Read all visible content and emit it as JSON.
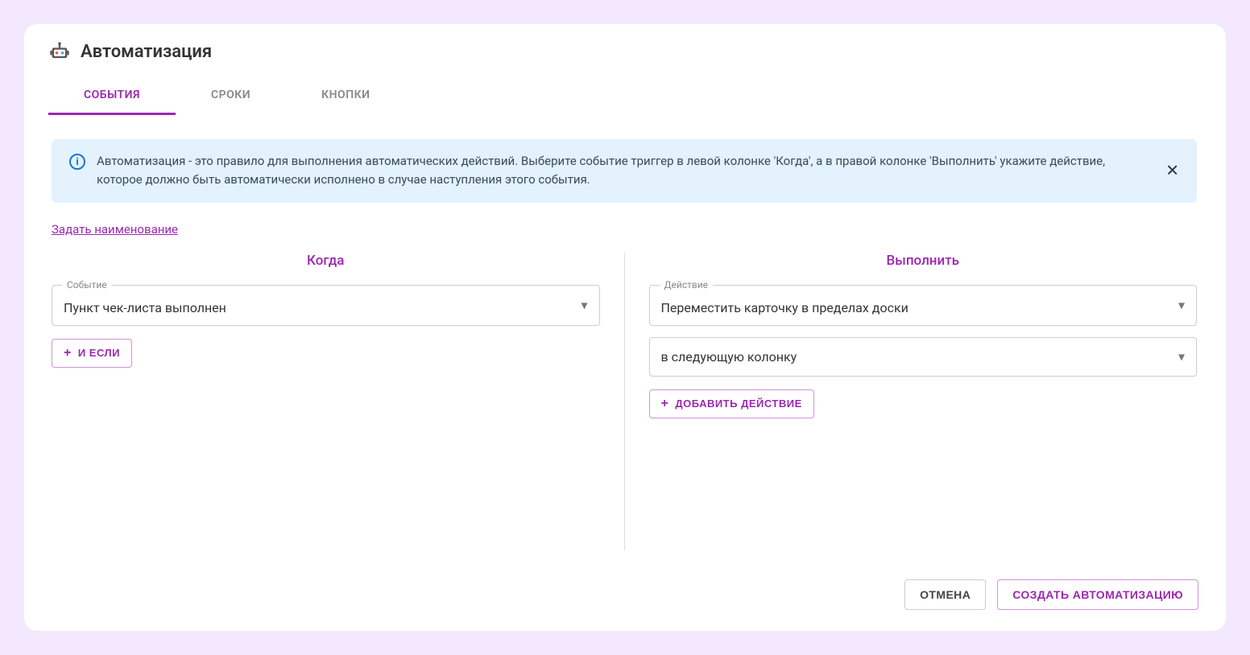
{
  "header": {
    "title": "Автоматизация"
  },
  "tabs": {
    "items": [
      {
        "label": "СОБЫТИЯ",
        "active": true
      },
      {
        "label": "СРОКИ",
        "active": false
      },
      {
        "label": "КНОПКИ",
        "active": false
      }
    ]
  },
  "info": {
    "text": "Автоматизация - это правило для выполнения автоматических действий. Выберите событие триггер в левой колонке 'Когда', а в правой колонке 'Выполнить' укажите действие, которое должно быть автоматически исполнено в случае наступления этого события."
  },
  "set_name_link": "Задать наименование",
  "columns": {
    "when": {
      "title": "Когда",
      "event_label": "Событие",
      "event_value": "Пункт чек-листа выполнен",
      "add_condition_label": "И ЕСЛИ"
    },
    "do": {
      "title": "Выполнить",
      "action_label": "Действие",
      "action_value": "Переместить карточку в пределах доски",
      "target_value": "в следующую колонку",
      "add_action_label": "ДОБАВИТЬ ДЕЙСТВИЕ"
    }
  },
  "footer": {
    "cancel": "ОТМЕНА",
    "create": "СОЗДАТЬ АВТОМАТИЗАЦИЮ"
  }
}
